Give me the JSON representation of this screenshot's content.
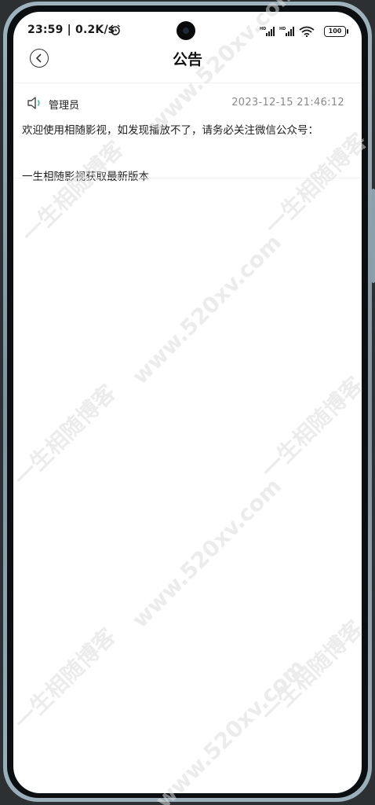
{
  "status_bar": {
    "time_speed": "23:59 | 0.2K/s",
    "battery": "100"
  },
  "nav": {
    "title": "公告"
  },
  "notice": {
    "sender": "管理员",
    "date": "2023-12-15 21:46:12",
    "body_line_1": "欢迎使用相随影视，如发现播放不了，请务必关注微信公众号：",
    "body_line_2": "一生相随影视获取最新版本"
  },
  "watermark": {
    "site": "www.520xv.com",
    "brand": "一生相随博客"
  }
}
